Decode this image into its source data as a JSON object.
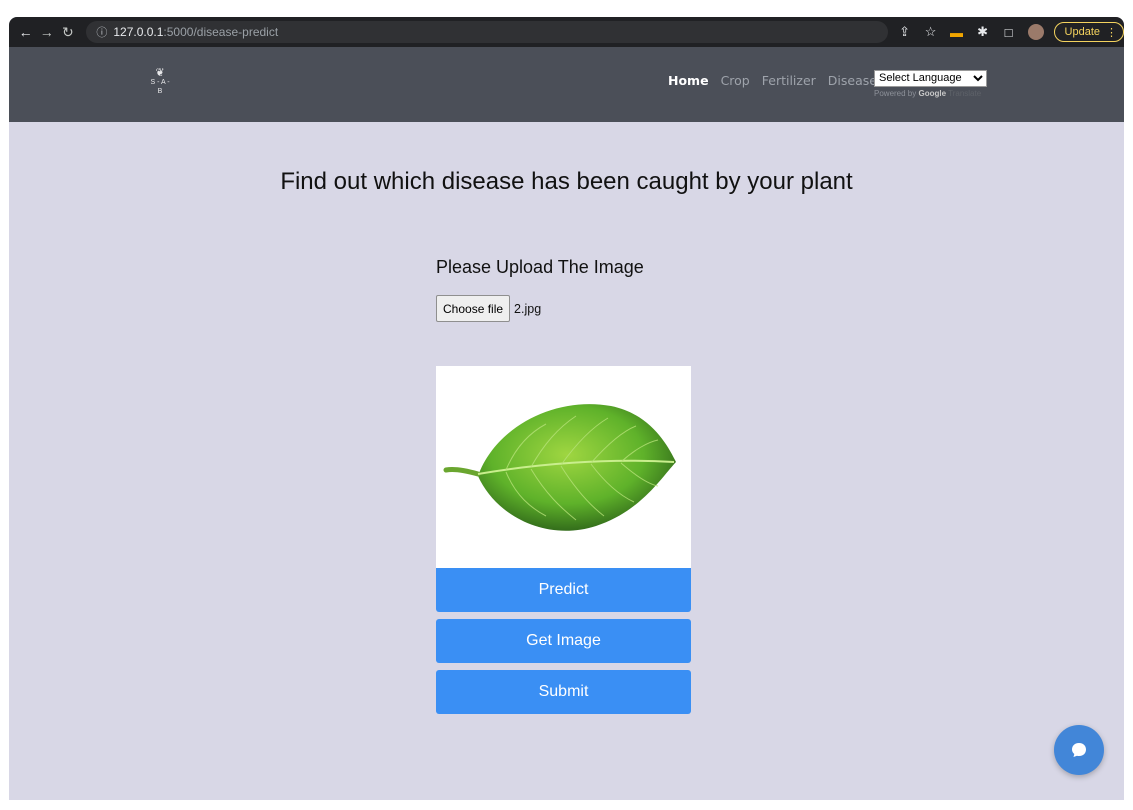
{
  "browser": {
    "url_host": "127.0.0.1",
    "url_path": ":5000/disease-predict",
    "update_label": "Update"
  },
  "navbar": {
    "logo_text": "S - A - B",
    "links": [
      {
        "label": "Home",
        "active": true
      },
      {
        "label": "Crop",
        "active": false
      },
      {
        "label": "Fertilizer",
        "active": false
      },
      {
        "label": "Disease",
        "active": false
      }
    ],
    "language_select": "Select Language",
    "powered_by": "Powered by",
    "google": "Google",
    "translate": "Translate"
  },
  "main": {
    "headline": "Find out which disease has been caught by your plant",
    "upload_label": "Please Upload The Image",
    "choose_file_label": "Choose file",
    "file_name": "2.jpg",
    "buttons": {
      "predict": "Predict",
      "get_image": "Get Image",
      "submit": "Submit"
    }
  },
  "colors": {
    "accent": "#3a8ff4",
    "navbar": "#4b4f58",
    "page_bg": "#d8d7e6"
  },
  "icons": [
    "back-arrow-icon",
    "forward-arrow-icon",
    "reload-icon",
    "info-icon",
    "share-icon",
    "star-icon",
    "extension-icon",
    "puzzle-icon",
    "sidepanel-icon",
    "profile-avatar",
    "chat-bubble-icon"
  ]
}
